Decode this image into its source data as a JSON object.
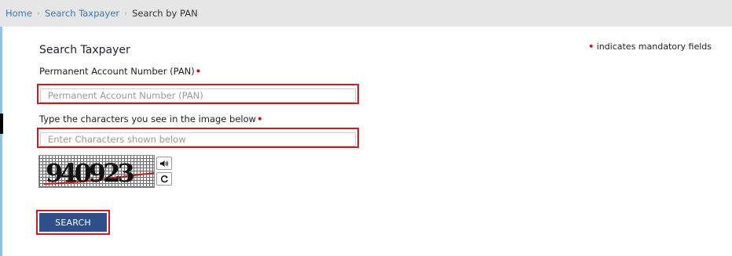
{
  "breadcrumb": {
    "home": "Home",
    "search_taxpayer": "Search Taxpayer",
    "current": "Search by PAN",
    "separator": "›"
  },
  "form": {
    "title": "Search Taxpayer",
    "mandatory_marker": "•",
    "mandatory_note": "indicates mandatory fields",
    "pan_label": "Permanent Account Number (PAN)",
    "pan_placeholder": "Permanent Account Number (PAN)",
    "captcha_label": "Type the characters you see in the image below",
    "captcha_placeholder": "Enter Characters shown below",
    "captcha_text": "940923",
    "audio_icon": "speaker-icon",
    "refresh_icon": "refresh-icon",
    "search_button": "SEARCH"
  },
  "colors": {
    "link": "#3c78b5",
    "highlight_border": "#d01a23",
    "button_bg": "#2f4f8a",
    "required": "#ee0000"
  }
}
